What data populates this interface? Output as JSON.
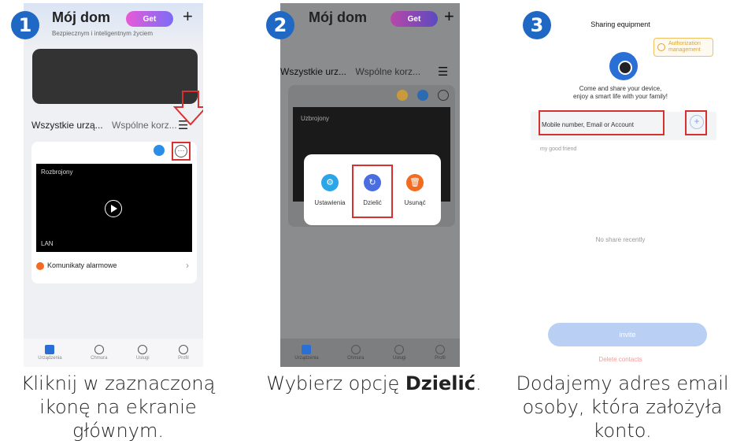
{
  "steps": [
    {
      "number": "1",
      "caption": "Kliknij w zaznaczoną ikonę na ekranie głównym."
    },
    {
      "number": "2",
      "caption_prefix": "Wybierz opcję ",
      "caption_bold": "Dzielić",
      "caption_suffix": "."
    },
    {
      "number": "3",
      "caption": "Dodajemy adres email osoby, która założyła konto."
    }
  ],
  "screen1": {
    "title": "Mój dom",
    "subtitle": "Bezpiecznym i inteligentnym życiem",
    "get_label": "Get",
    "plus": "+",
    "tab_all": "Wszystkie urzą...",
    "tab_shared": "Wspólne korz...",
    "camera_status": "Rozbrojony",
    "network": "LAN",
    "alarm_label": "Komunikaty alarmowe",
    "nav": [
      "Urządzenia",
      "Chmura",
      "Usługi",
      "Profil"
    ],
    "nav_badge": "50%"
  },
  "screen2": {
    "title": "Mój dom",
    "get_label": "Get",
    "plus": "+",
    "tab_all": "Wszystkie urz...",
    "tab_shared": "Wspólne korz...",
    "camera_status": "Uzbrojony",
    "popup": {
      "settings": "Ustawienia",
      "share": "Dzielić",
      "delete": "Usunąć"
    },
    "nav": [
      "Urządzenia",
      "Chmura",
      "Usługi",
      "Profil"
    ]
  },
  "screen3": {
    "title": "Sharing equipment",
    "auth_label": "Authorization management",
    "message_line1": "Come and share your device,",
    "message_line2": "enjoy a smart life with your family!",
    "input_placeholder": "Mobile number, Email or Account",
    "friend_label": "my good friend",
    "no_share": "No share recently",
    "invite_label": "invite",
    "delete_contacts": "Delete contacts"
  },
  "colors": {
    "badge": "#1f68c4",
    "highlight": "#d8302f",
    "accent_blue": "#2a6fd6",
    "invite_disabled": "#b9cff3"
  }
}
